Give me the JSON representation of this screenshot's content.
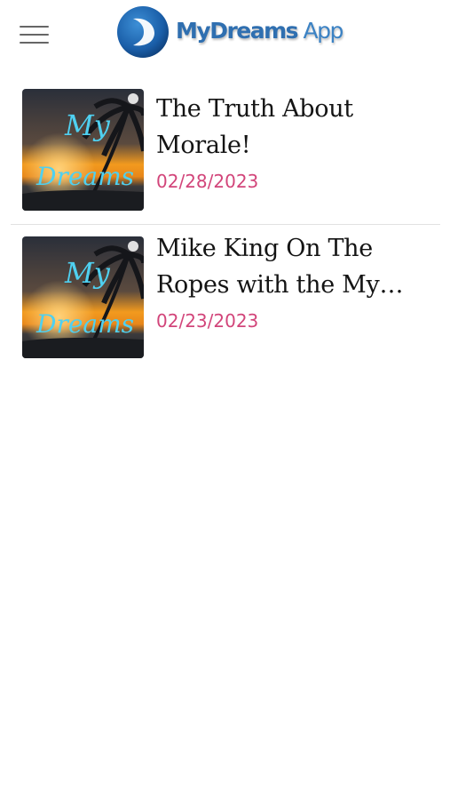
{
  "header": {
    "menu_icon": "hamburger-menu-icon",
    "logo": {
      "word1": "My",
      "word2": "Dreams",
      "word3": "App",
      "brand_color": "#2f6fb0"
    }
  },
  "feed": {
    "items": [
      {
        "title": "The Truth About Morale!",
        "date": "02/28/2023",
        "thumb_text_1": "My",
        "thumb_text_2": "Dreams"
      },
      {
        "title": "Mike King On The Ropes with the My…",
        "date": "02/23/2023",
        "thumb_text_1": "My",
        "thumb_text_2": "Dreams"
      }
    ],
    "date_color": "#d2457a"
  }
}
